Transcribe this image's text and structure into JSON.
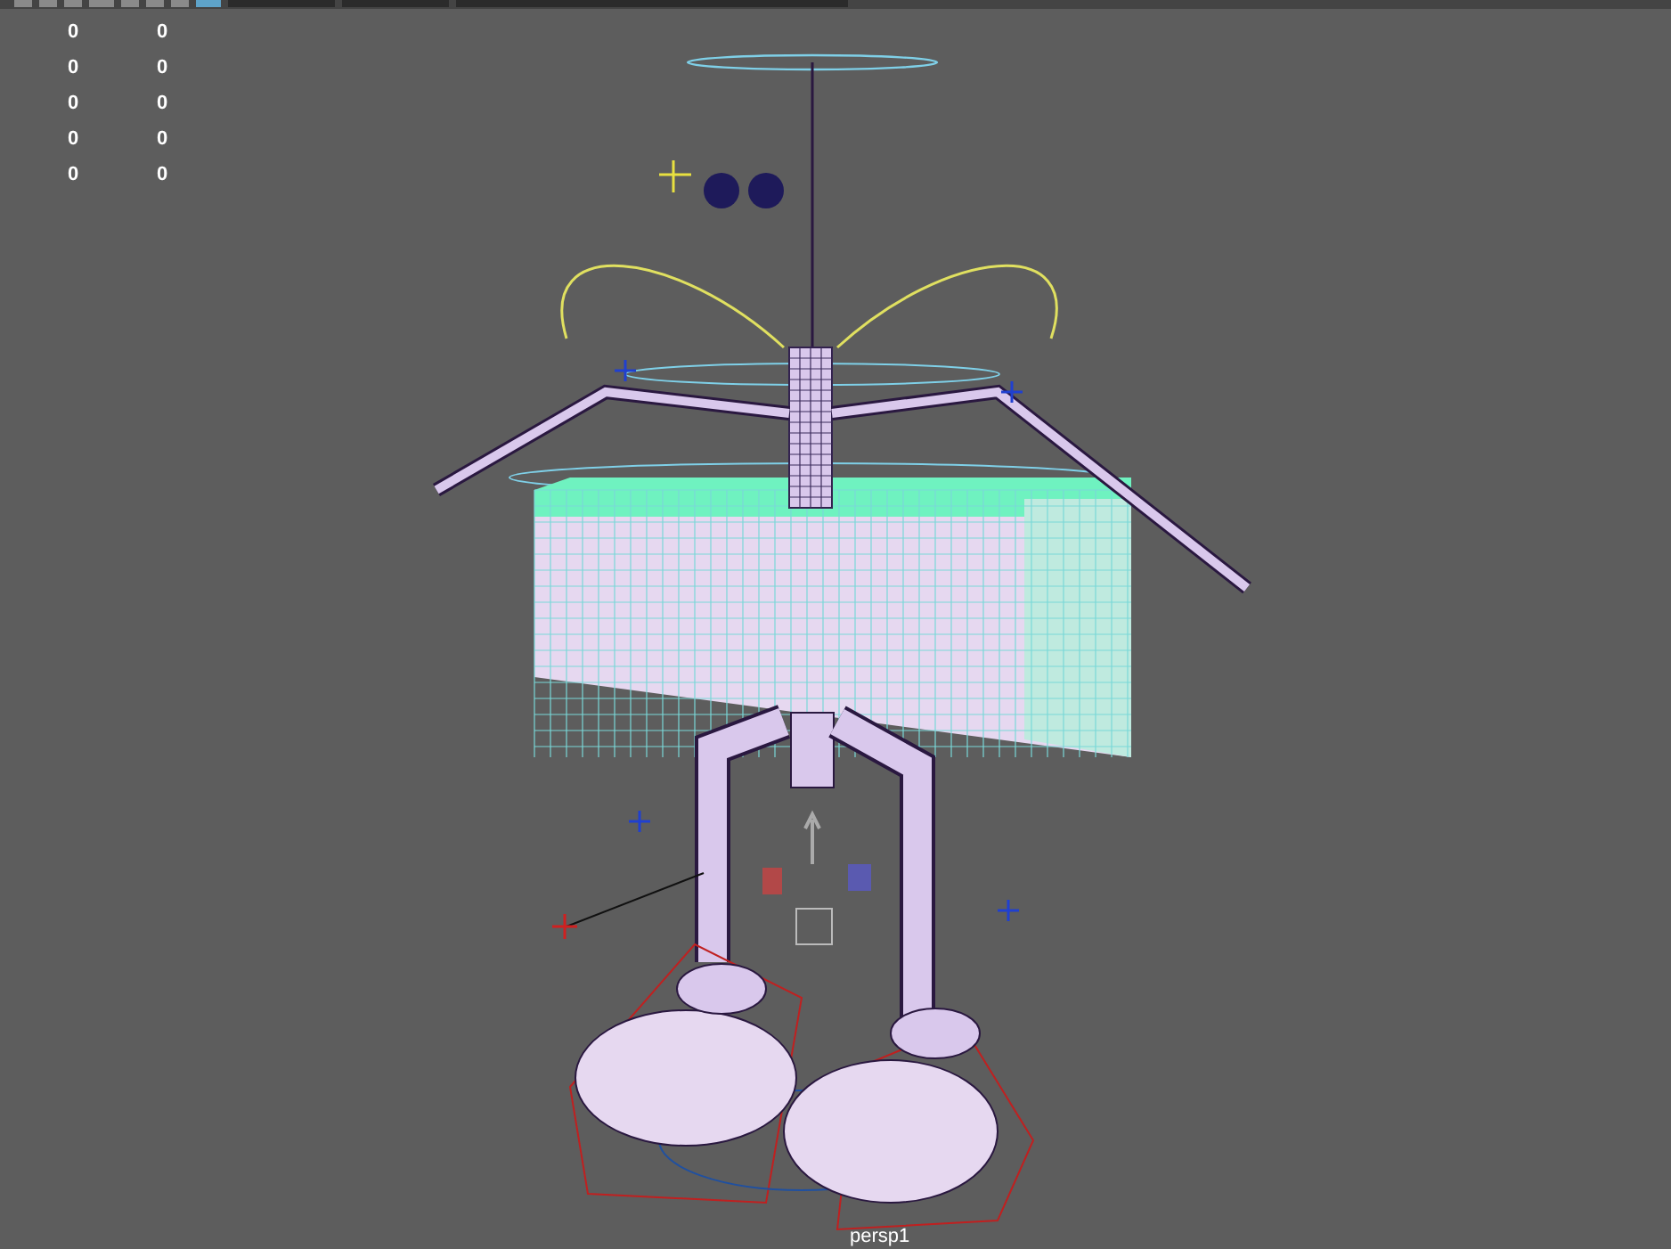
{
  "hud": {
    "rows": [
      {
        "column_1": "0",
        "column_2": "0"
      },
      {
        "column_1": "0",
        "column_2": "0"
      },
      {
        "column_1": "0",
        "column_2": "0"
      },
      {
        "column_1": "0",
        "column_2": "0"
      },
      {
        "column_1": "0",
        "column_2": "0"
      }
    ]
  },
  "viewport": {
    "camera_label": "persp1"
  }
}
